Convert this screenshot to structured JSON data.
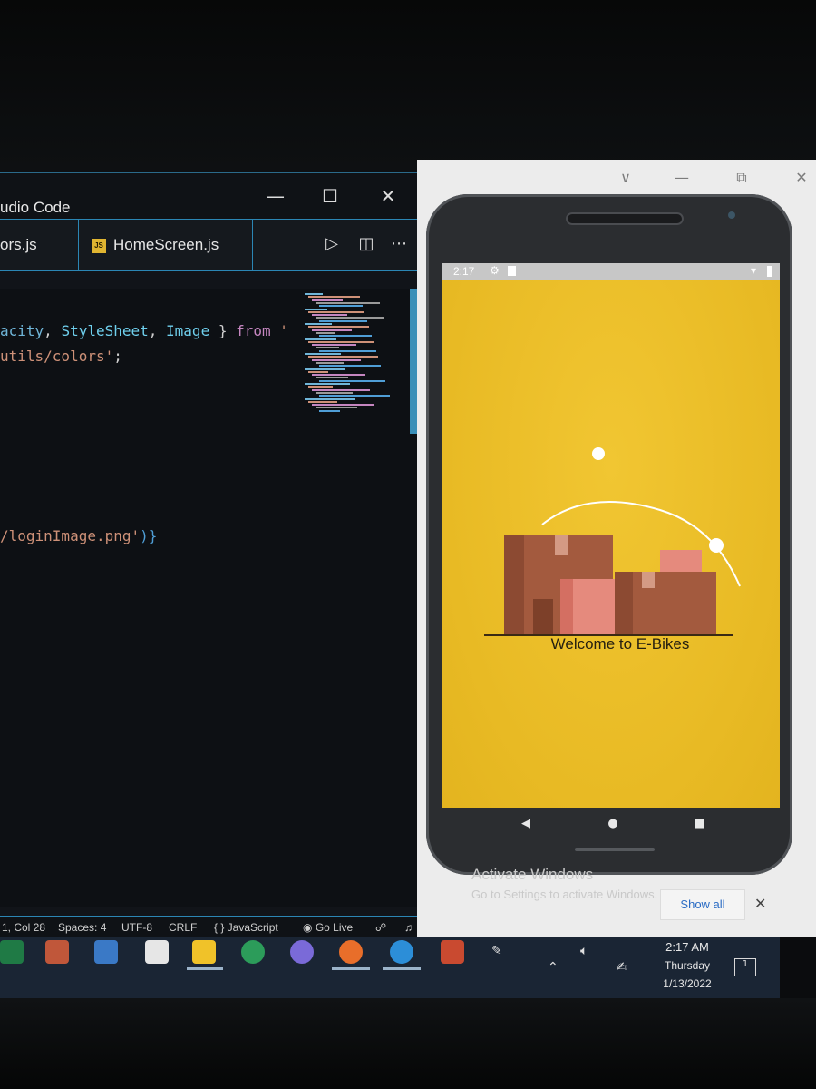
{
  "vscode": {
    "title": "udio Code",
    "window_controls": [
      "—",
      "☐",
      "✕"
    ],
    "tabs": [
      {
        "label": "ors.js",
        "icon": "js-file-icon",
        "badge": ""
      },
      {
        "label": "HomeScreen.js",
        "icon": "js-file-icon",
        "badge": "JS"
      }
    ],
    "tab_actions": [
      "run-icon",
      "split-editor-icon",
      "more-icon"
    ],
    "code_lines": [
      {
        "tokens": [
          [
            "acity",
            "#6fb5d8"
          ],
          [
            ", ",
            "#cfcfcf"
          ],
          [
            "StyleSheet",
            "#6fd0ee"
          ],
          [
            ", ",
            "#cfcfcf"
          ],
          [
            "Image",
            "#6fd0ee"
          ],
          [
            " } ",
            "#cfcfcf"
          ],
          [
            "from",
            "#c586c0"
          ],
          [
            " '",
            "#ce9178"
          ]
        ]
      },
      {
        "tokens": [
          [
            "utils/colors'",
            "#ce9178"
          ],
          [
            ";",
            "#cfcfcf"
          ]
        ]
      },
      {
        "tokens": [
          [
            "/loginImage.png'",
            "#ce9178"
          ],
          [
            ")}",
            "#4f9ed6"
          ]
        ]
      }
    ],
    "status": [
      {
        "text": "1, Col 28"
      },
      {
        "text": "Spaces: 4"
      },
      {
        "text": "UTF-8"
      },
      {
        "text": "CRLF"
      },
      {
        "text": "{ } JavaScript"
      },
      {
        "text": "Go Live"
      }
    ]
  },
  "emulator": {
    "window_controls": [
      "∨",
      "—",
      "⧉",
      "✕"
    ],
    "status_time": "2:17",
    "status_icons": [
      "settings-icon",
      "sd-card-icon",
      "wifi-icon",
      "battery-icon"
    ],
    "welcome_text": "Welcome to E-Bikes",
    "nav": [
      "back-icon",
      "home-icon",
      "recents-icon"
    ],
    "colors": {
      "screen_bg": "#e9bc27",
      "box": "#a35a3e",
      "box_light": "#c47a5d",
      "pink": "#e58a7d"
    }
  },
  "activation": {
    "title": "Activate Windows",
    "subtitle": "Go to Settings to activate Windows.",
    "show_all": "Show all"
  },
  "taskbar": {
    "apps": [
      "excel-icon",
      "media-icon",
      "mail-icon",
      "notepad-icon",
      "sticky-notes-icon",
      "chrome-icon",
      "github-icon",
      "firefox-icon",
      "edge-icon",
      "powerpoint-icon"
    ],
    "clock_time": "2:17 AM",
    "clock_day": "Thursday",
    "clock_date": "1/13/2022",
    "notification_count": "1"
  }
}
